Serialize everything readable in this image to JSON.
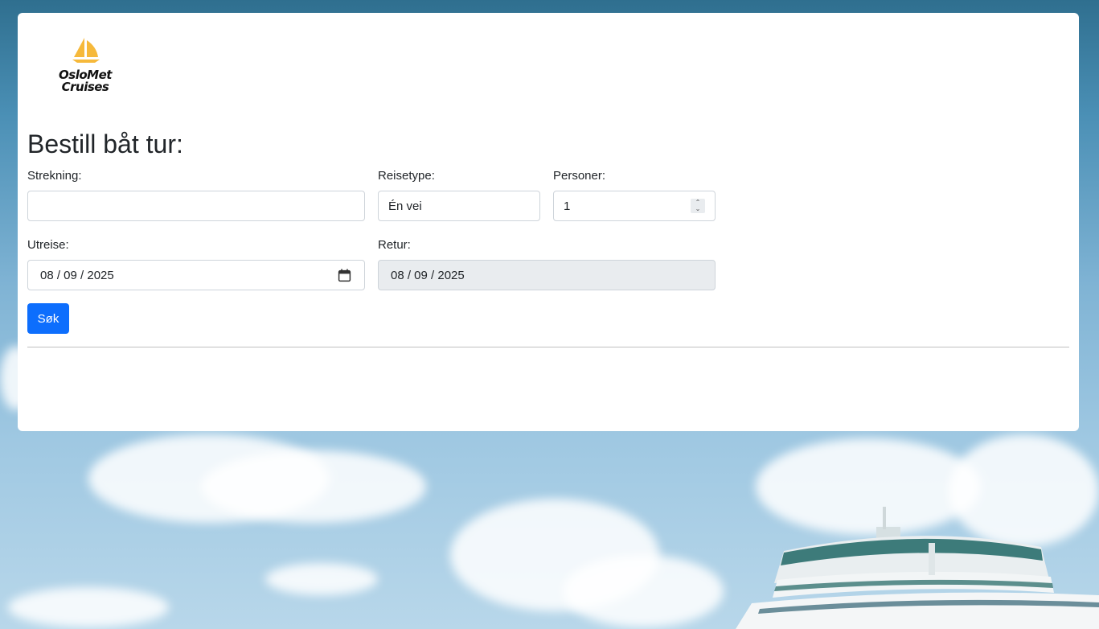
{
  "brand": {
    "logo_line1": "OsloMet",
    "logo_line2": "Cruises",
    "logo_color": "#f6b93b"
  },
  "form": {
    "title": "Bestill båt tur:",
    "route_label": "Strekning:",
    "route_value": "",
    "trip_type_label": "Reisetype:",
    "trip_type_value": "Én vei",
    "persons_label": "Personer:",
    "persons_value": "1",
    "departure_label": "Utreise:",
    "departure_value": "08 / 09 / 2025",
    "return_label": "Retur:",
    "return_value": "08 / 09 / 2025",
    "search_button": "Søk"
  },
  "colors": {
    "primary": "#0d6efd",
    "disabled_bg": "#e9ecef"
  },
  "icons": {
    "calendar": "calendar-icon",
    "spinner": "number-spinner-icon",
    "logo": "sailboat-icon"
  }
}
